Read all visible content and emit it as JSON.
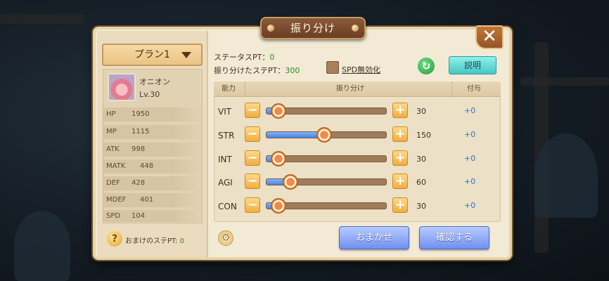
{
  "window": {
    "title": "振り分け"
  },
  "plan": {
    "selected": "プラン1"
  },
  "character": {
    "name": "オニオン",
    "level": "Lv.30",
    "stats": [
      {
        "key": "HP",
        "value": "1950"
      },
      {
        "key": "MP",
        "value": "1115"
      },
      {
        "key": "ATK",
        "value": "998"
      },
      {
        "key": "MATK",
        "value": "448"
      },
      {
        "key": "DEF",
        "value": "428"
      },
      {
        "key": "MDEF",
        "value": "401"
      },
      {
        "key": "SPD",
        "value": "104"
      }
    ],
    "bonus_label": "おまけのステPT:",
    "bonus_value": "0"
  },
  "points": {
    "status_label": "ステータスPT：",
    "status_value": "0",
    "allocated_label": "振り分けたステPT：",
    "allocated_value": "300"
  },
  "spd_toggle": {
    "label": "SPD無効化",
    "checked": false
  },
  "buttons": {
    "explain": "説明",
    "auto": "おまかせ",
    "confirm": "確認する",
    "minus": "−",
    "plus": "+",
    "close": "✕",
    "refresh": "↻",
    "gear": "⚙",
    "help": "?"
  },
  "table": {
    "headers": {
      "ability": "能力",
      "allocation": "振り分け",
      "bonus": "付与"
    },
    "rows": [
      {
        "name": "VIT",
        "value": "30",
        "bonus": "+0",
        "level": 0.1
      },
      {
        "name": "STR",
        "value": "150",
        "bonus": "+0",
        "level": 0.48
      },
      {
        "name": "INT",
        "value": "30",
        "bonus": "+0",
        "level": 0.1
      },
      {
        "name": "AGI",
        "value": "60",
        "bonus": "+0",
        "level": 0.2
      },
      {
        "name": "CON",
        "value": "30",
        "bonus": "+0",
        "level": 0.1
      }
    ]
  },
  "icons": {
    "close": "close-icon",
    "caret": "chevron-down-icon",
    "refresh": "refresh-icon",
    "gear": "gear-icon",
    "help": "question-icon"
  }
}
